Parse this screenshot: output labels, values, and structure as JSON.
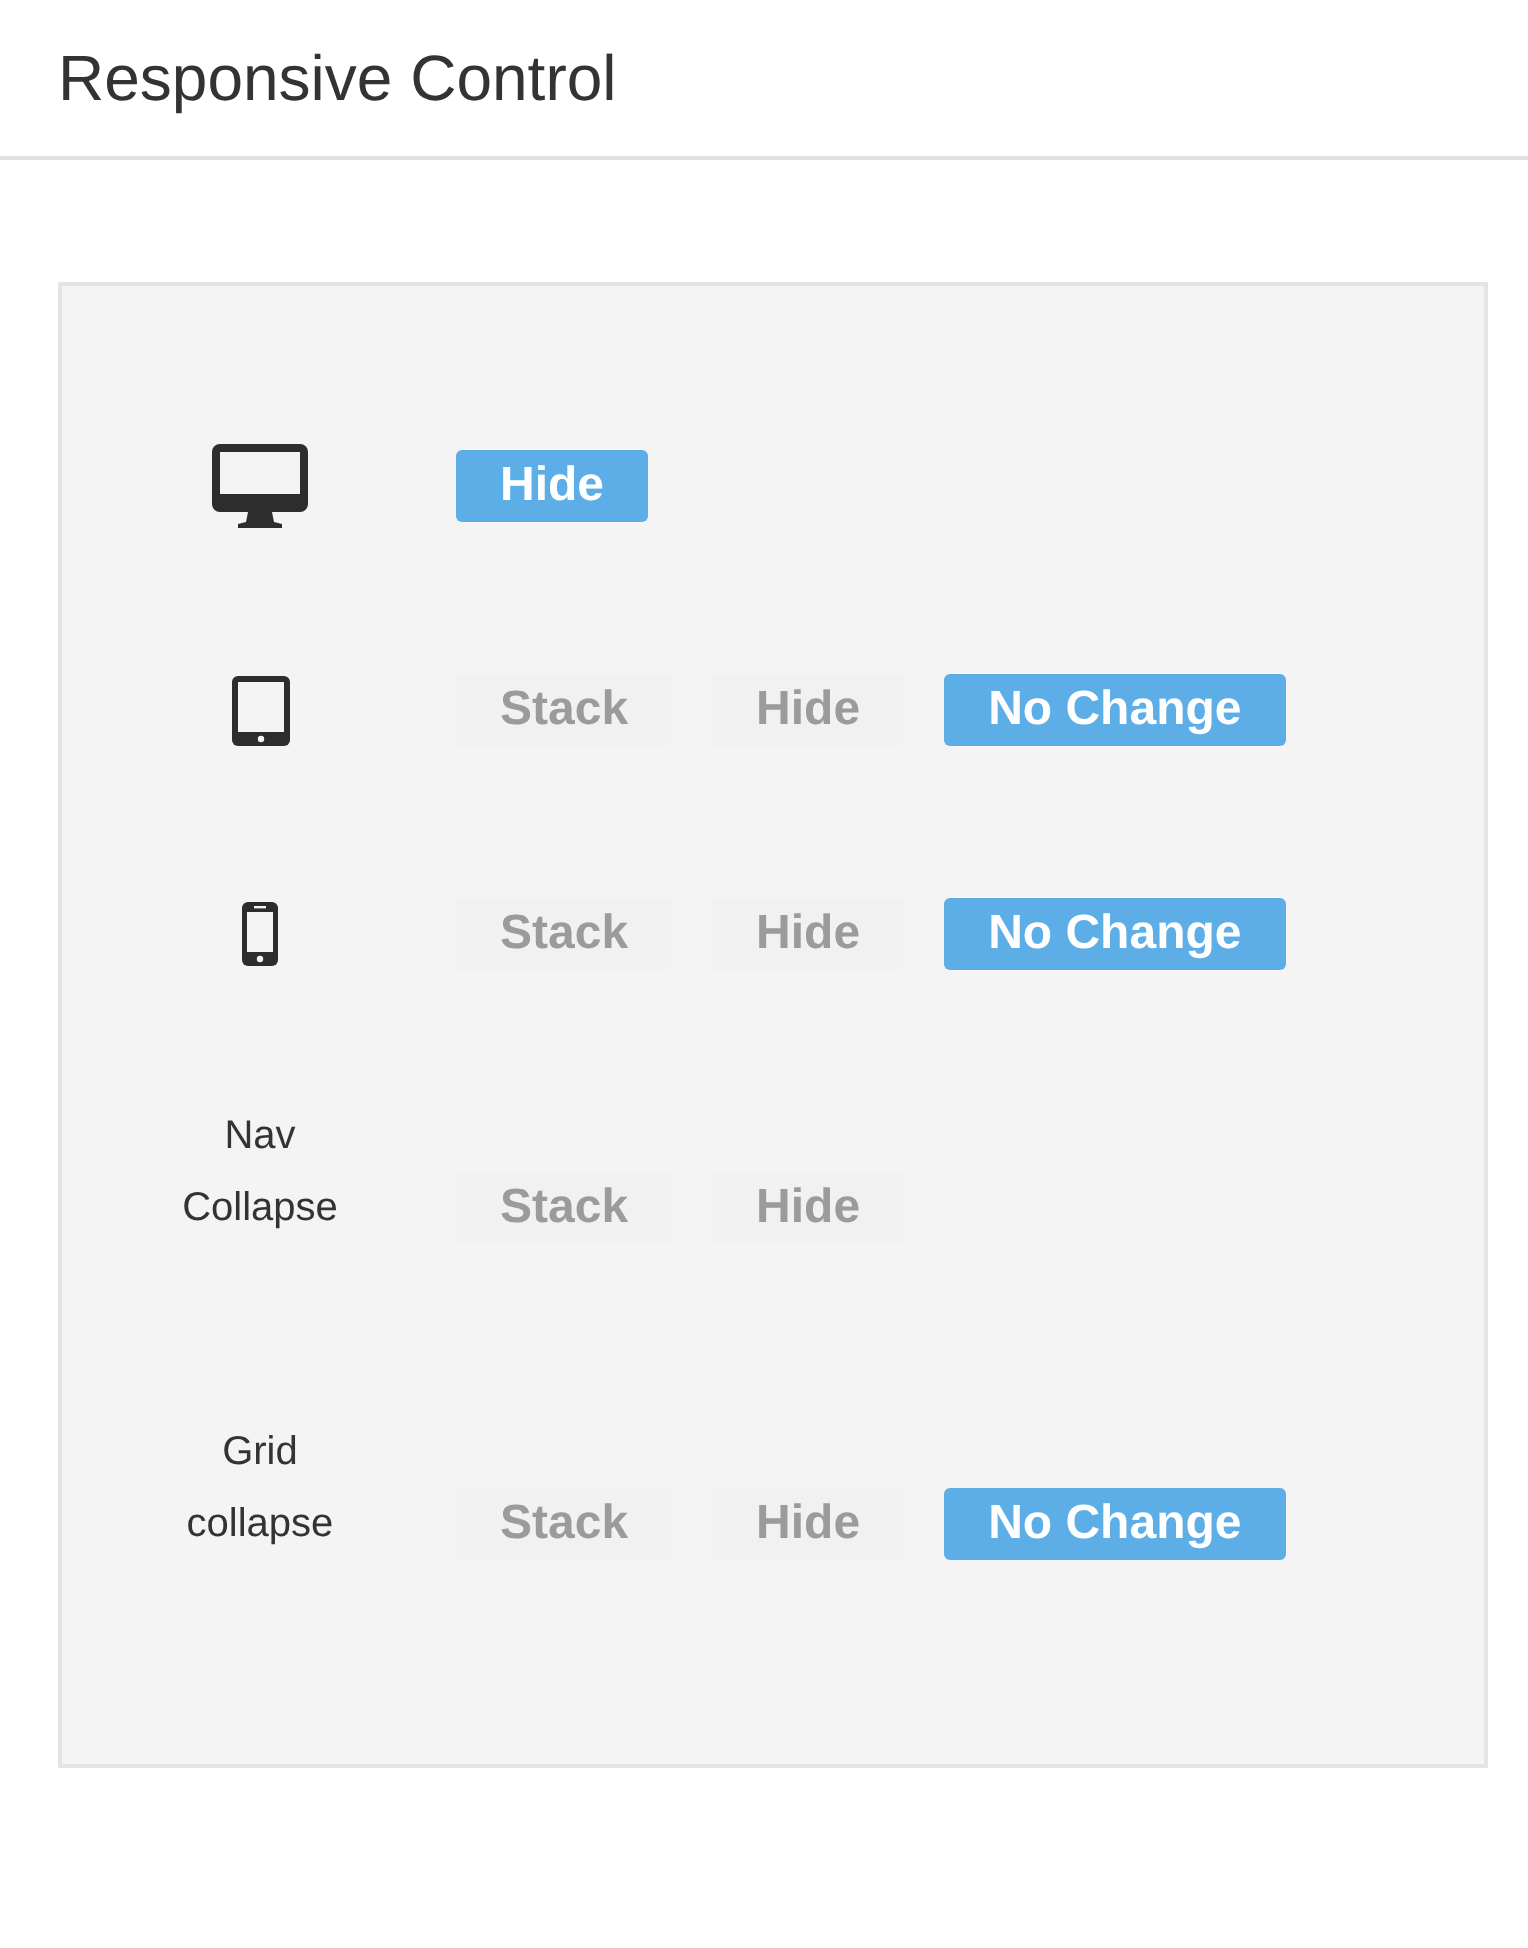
{
  "title": "Responsive Control",
  "rows": [
    {
      "kind": "desktop",
      "options": [
        {
          "label": "Hide",
          "selected": true
        }
      ]
    },
    {
      "kind": "tablet",
      "options": [
        {
          "label": "Stack",
          "selected": false
        },
        {
          "label": "Hide",
          "selected": false
        },
        {
          "label": "No Change",
          "selected": true
        }
      ]
    },
    {
      "kind": "phone",
      "options": [
        {
          "label": "Stack",
          "selected": false
        },
        {
          "label": "Hide",
          "selected": false
        },
        {
          "label": "No Change",
          "selected": true
        }
      ]
    },
    {
      "kind": "label",
      "lines": [
        "Nav",
        "Collapse"
      ],
      "options": [
        {
          "label": "Stack",
          "selected": false
        },
        {
          "label": "Hide",
          "selected": false
        }
      ]
    },
    {
      "kind": "label",
      "lines": [
        "Grid",
        "collapse"
      ],
      "options": [
        {
          "label": "Stack",
          "selected": false
        },
        {
          "label": "Hide",
          "selected": false
        },
        {
          "label": "No Change",
          "selected": true
        }
      ]
    }
  ]
}
